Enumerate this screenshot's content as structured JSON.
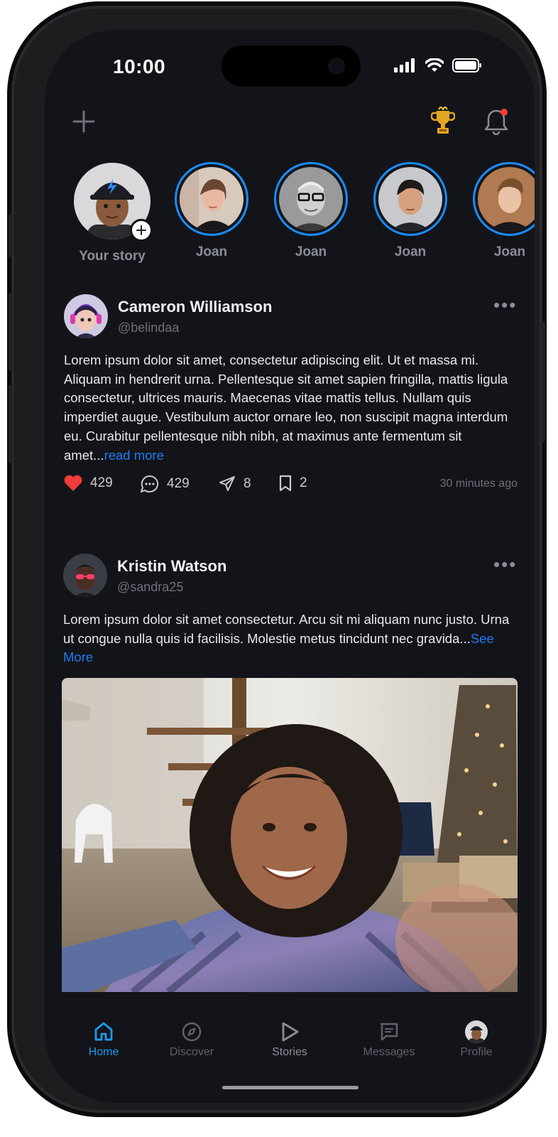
{
  "status_bar": {
    "time": "10:00"
  },
  "header": {
    "icons": [
      "plus-icon",
      "trophy-icon",
      "bell-icon"
    ],
    "notification_dot_color": "#ff3b30"
  },
  "stories": [
    {
      "label": "Your story",
      "is_own": true
    },
    {
      "label": "Joan"
    },
    {
      "label": "Joan"
    },
    {
      "label": "Joan"
    },
    {
      "label": "Joan"
    }
  ],
  "posts": [
    {
      "name": "Cameron Williamson",
      "handle": "@belindaa",
      "text": "Lorem ipsum dolor sit amet, consectetur adipiscing elit. Ut et massa mi. Aliquam in hendrerit urna. Pellentesque sit amet sapien fringilla, mattis ligula consectetur, ultrices mauris. Maecenas vitae mattis tellus. Nullam quis imperdiet augue. Vestibulum auctor ornare leo, non suscipit magna interdum eu. Curabitur pellentesque nibh nibh, at maximus ante fermentum sit amet...",
      "link": "read more",
      "likes": "429",
      "comments": "429",
      "shares": "8",
      "saves": "2",
      "time_ago": "30 minutes ago"
    },
    {
      "name": "Kristin Watson",
      "handle": "@sandra25",
      "text": "Lorem ipsum dolor sit amet consectetur. Arcu sit mi aliquam nunc justo. Urna ut congue nulla quis id facilisis. Molestie metus tincidunt nec gravida...",
      "link": "See More"
    }
  ],
  "tabs": [
    {
      "label": "Home",
      "icon": "home-icon",
      "active": true
    },
    {
      "label": "Discover",
      "icon": "compass-icon"
    },
    {
      "label": "Stories",
      "icon": "play-icon"
    },
    {
      "label": "Messages",
      "icon": "message-icon"
    },
    {
      "label": "Profile",
      "icon": "avatar"
    }
  ],
  "colors": {
    "accent": "#1b9cf2",
    "link": "#1e7cf2",
    "background": "#131419",
    "like": "#f23b3b"
  }
}
